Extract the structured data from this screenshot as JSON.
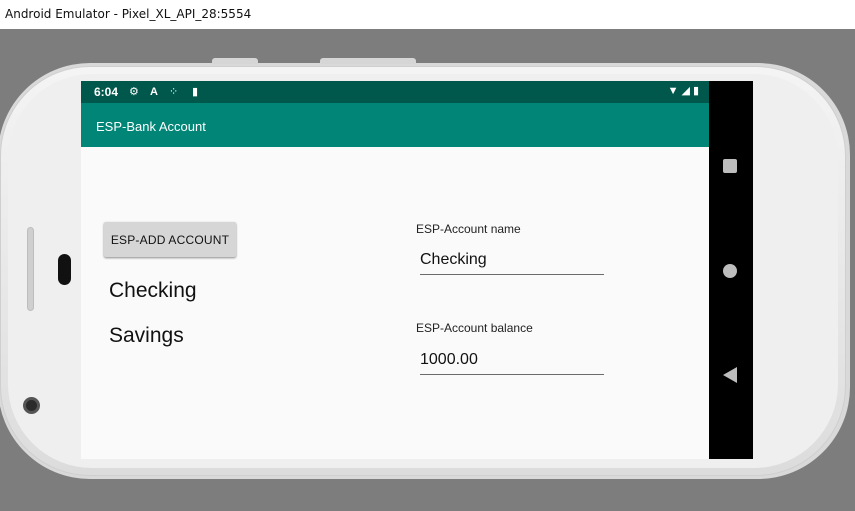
{
  "window": {
    "title": "Android Emulator - Pixel_XL_API_28:5554"
  },
  "status_bar": {
    "time": "6:04",
    "left_icons": [
      "gear-icon",
      "app-a-icon",
      "dots-icon",
      "sd-card-icon"
    ],
    "right_icons": [
      "wifi-icon",
      "signal-icon",
      "battery-icon"
    ]
  },
  "app_bar": {
    "title": "ESP-Bank Account"
  },
  "actions": {
    "add_account_label": "ESP-ADD ACCOUNT"
  },
  "accounts": [
    "Checking",
    "Savings"
  ],
  "form": {
    "name_label": "ESP-Account name",
    "name_value": "Checking",
    "balance_label": "ESP-Account balance",
    "balance_value": "1000.00"
  },
  "nav_bar": {
    "icons": [
      "recents-icon",
      "home-icon",
      "back-icon"
    ]
  },
  "colors": {
    "status_bar": "#00574b",
    "app_bar": "#008577",
    "screen_bg": "#fafafa"
  }
}
